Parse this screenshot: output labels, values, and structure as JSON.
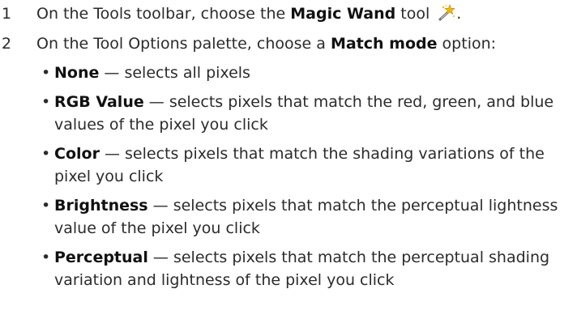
{
  "steps": [
    {
      "number": "1",
      "pre": "On the Tools toolbar, choose the ",
      "bold": "Magic Wand",
      "post": " tool",
      "icon": "magic-wand-icon",
      "end": "."
    },
    {
      "number": "2",
      "pre": "On the Tool Options palette, choose a ",
      "bold": "Match mode",
      "post": " option:"
    }
  ],
  "bullet_glyph": "•",
  "options": [
    {
      "term": "None",
      "desc": " — selects all pixels"
    },
    {
      "term": "RGB Value",
      "desc": " — selects pixels that match the red, green, and blue values of the pixel you click"
    },
    {
      "term": "Color",
      "desc": " — selects pixels that match the shading variations of the pixel you click"
    },
    {
      "term": "Brightness",
      "desc": " — selects pixels that match the perceptual lightness value of the pixel you click"
    },
    {
      "term": "Perceptual",
      "desc": " — selects pixels that match the perceptual shading variation and lightness of the pixel you click"
    }
  ],
  "colors": {
    "text": "#2b2b2b",
    "icon_handle": "#6e6e6e",
    "icon_star": "#f2b705"
  }
}
